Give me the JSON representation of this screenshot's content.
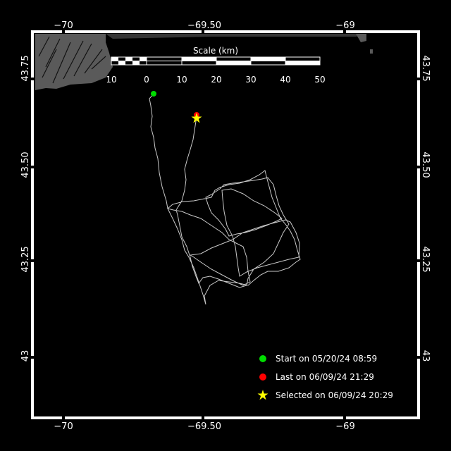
{
  "map": {
    "lon_ticks": [
      "−70",
      "−69.50",
      "−69"
    ],
    "lat_ticks": [
      "43.75",
      "43.50",
      "43.25",
      "43"
    ],
    "colors": {
      "background": "#000000",
      "land": "#5a5a5a",
      "track": "#c8c8c8",
      "frame": "#ffffff",
      "start": "#00dd00",
      "last": "#ff0000",
      "selected": "#ffff00"
    }
  },
  "scale": {
    "title": "Scale (km)",
    "ticks": [
      "10",
      "0",
      "10",
      "20",
      "30",
      "40",
      "50"
    ]
  },
  "legend": {
    "start": "Start on 05/20/24 08:59",
    "last": "Last on 06/09/24 21:29",
    "selected": "Selected on 06/09/24 20:29"
  }
}
